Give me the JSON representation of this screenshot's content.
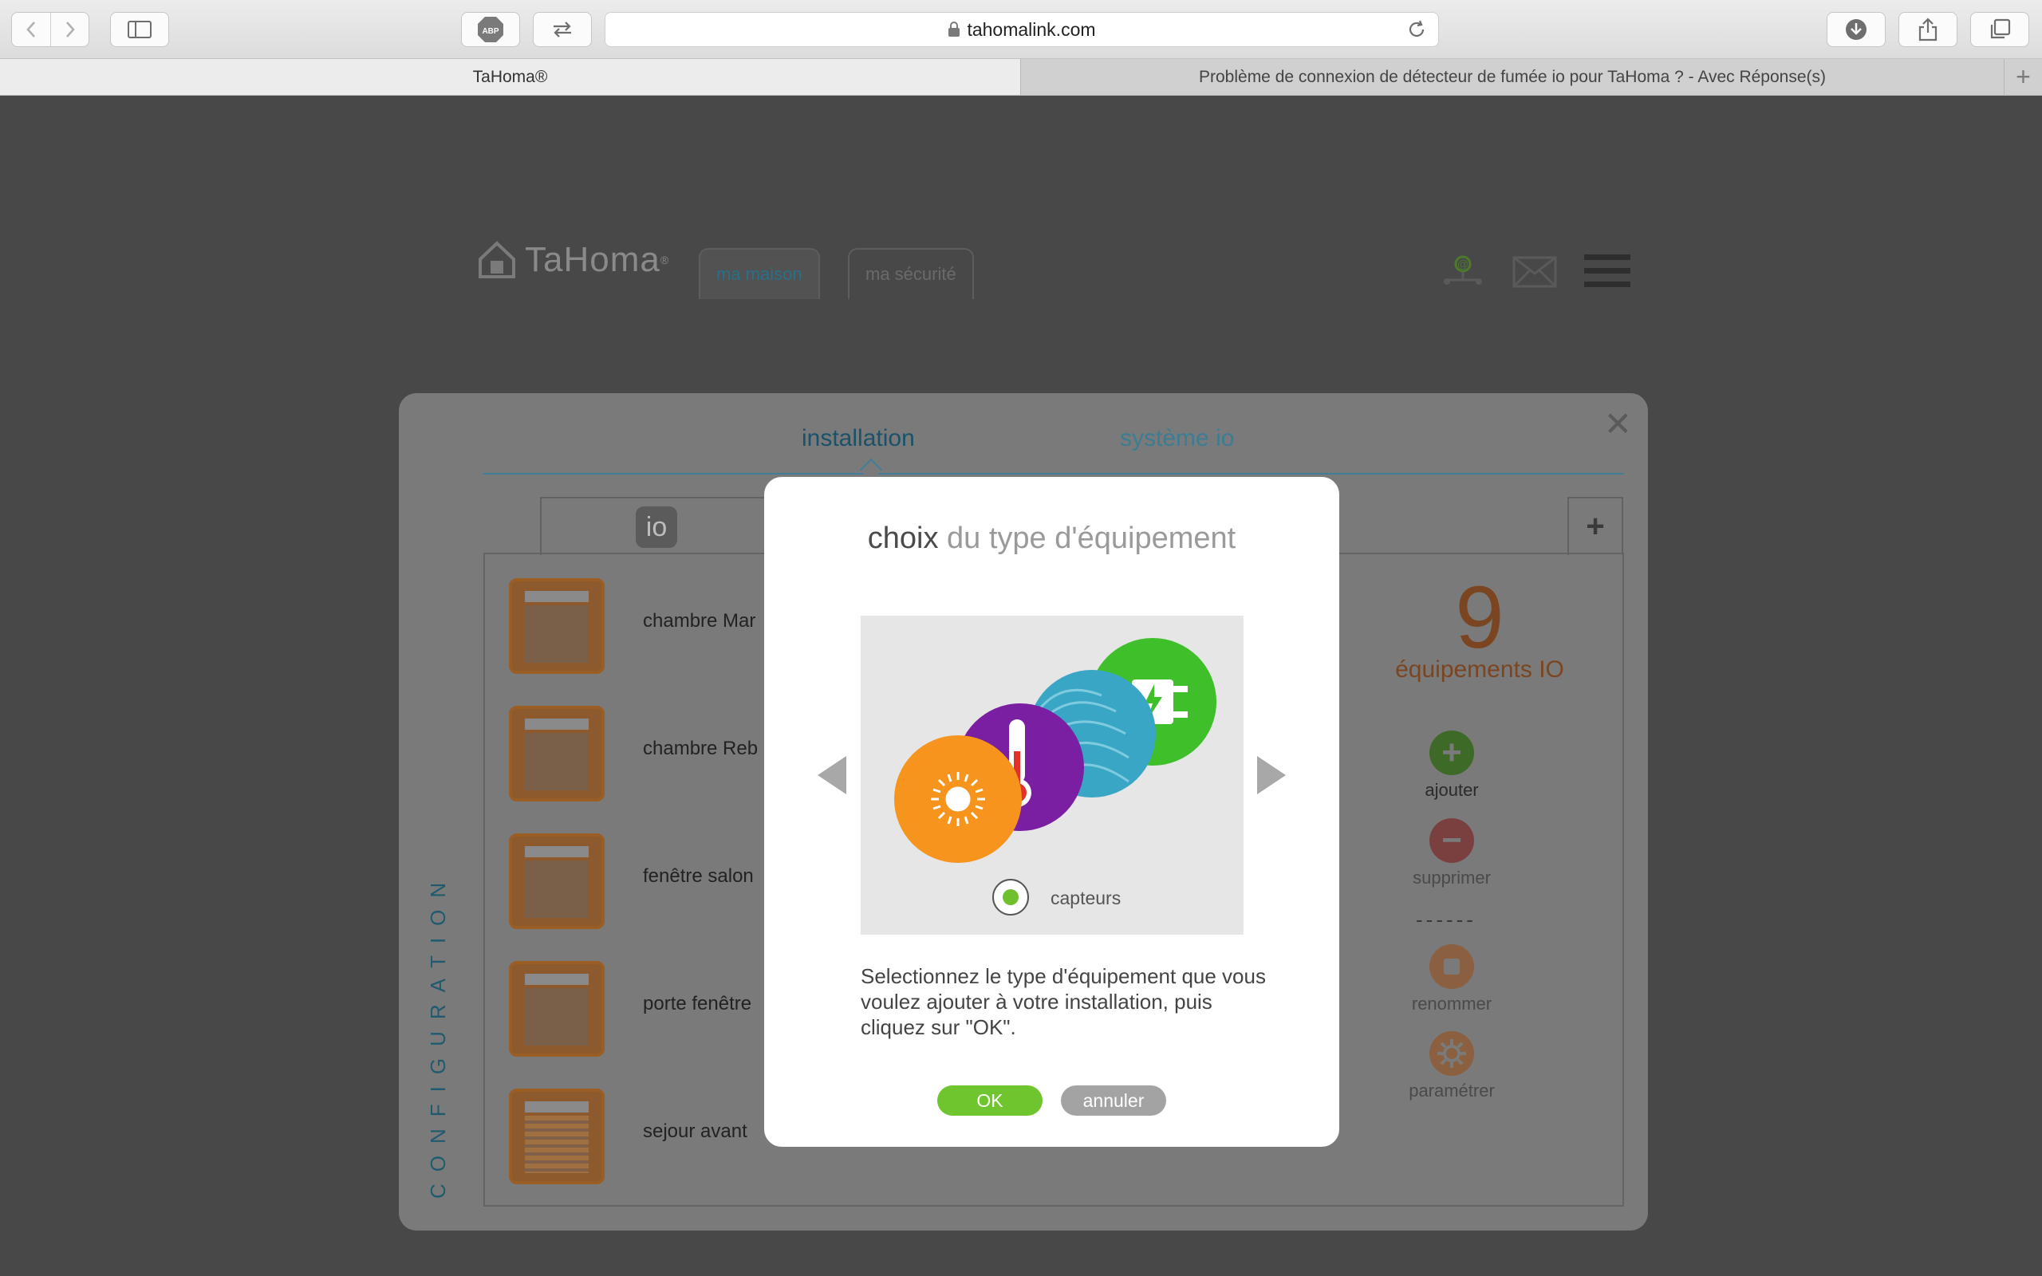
{
  "browser": {
    "url": "tahomalink.com",
    "tabs": [
      {
        "label": "TaHoma®"
      },
      {
        "label": "Problème de connexion de détecteur de fumée io pour TaHoma ? - Avec Réponse(s)"
      }
    ],
    "new_tab_label": "+"
  },
  "app": {
    "logo_text": "TaHoma",
    "logo_mark": "®",
    "nav": [
      "ma maison",
      "ma sécurité"
    ]
  },
  "config": {
    "tabs": {
      "installation": "installation",
      "systeme": "système io"
    },
    "io_badge": "io",
    "plus_label": "+",
    "vertical_label": "CONFIGURATION",
    "devices": [
      {
        "name": "chambre Mar",
        "icon": "window-icon"
      },
      {
        "name": "chambre Reb",
        "icon": "window-icon"
      },
      {
        "name": "fenêtre salon",
        "icon": "window-icon"
      },
      {
        "name": "porte fenêtre",
        "icon": "window-icon"
      },
      {
        "name": "sejour avant",
        "icon": "shutter-icon"
      }
    ],
    "count": "9",
    "count_label": "équipements IO",
    "separator": "------",
    "actions": {
      "add": "ajouter",
      "delete": "supprimer",
      "rename": "renommer",
      "settings": "paramétrer"
    }
  },
  "modal": {
    "title_strong": "choix",
    "title_rest": " du type d'équipement",
    "category": "capteurs",
    "instructions": "Selectionnez le type d'équipement que vous voulez ajouter à votre installation, puis cliquez sur \"OK\".",
    "ok": "OK",
    "cancel": "annuler"
  },
  "colors": {
    "orange": "#f7941d",
    "purple": "#7a1fa2",
    "teal": "#3aa6c6",
    "green": "#3fbf2a",
    "ok_green": "#6ec52d",
    "accent_teal": "#1f5a6f"
  }
}
